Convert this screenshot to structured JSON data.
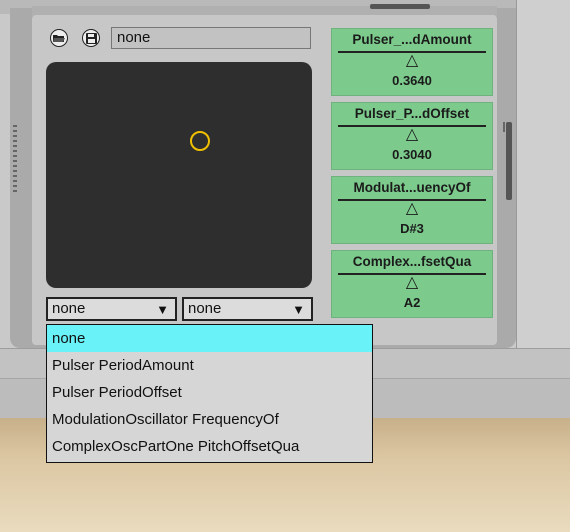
{
  "header": {
    "preset_name": "none"
  },
  "icons": {
    "open": "folder-open-icon",
    "save": "save-disk-icon"
  },
  "knobs": [
    {
      "title": "Pulser_...dAmount",
      "value": "0.3640"
    },
    {
      "title": "Pulser_P...dOffset",
      "value": "0.3040"
    },
    {
      "title": "Modulat...uencyOf",
      "value": "D#3"
    },
    {
      "title": "Complex...fsetQua",
      "value": "A2"
    }
  ],
  "dropdowns": {
    "x_target": "none",
    "y_target": "none"
  },
  "menu": {
    "items": [
      "none",
      "Pulser PeriodAmount",
      "Pulser PeriodOffset",
      "ModulationOscillator FrequencyOf",
      "ComplexOscPartOne PitchOffsetQua"
    ],
    "selected_index": 0
  },
  "colors": {
    "knob_bg": "#7ccb8d",
    "pad_bg": "#2e2e2e",
    "pad_dot": "#f0c000",
    "menu_highlight": "#69f2f7"
  }
}
